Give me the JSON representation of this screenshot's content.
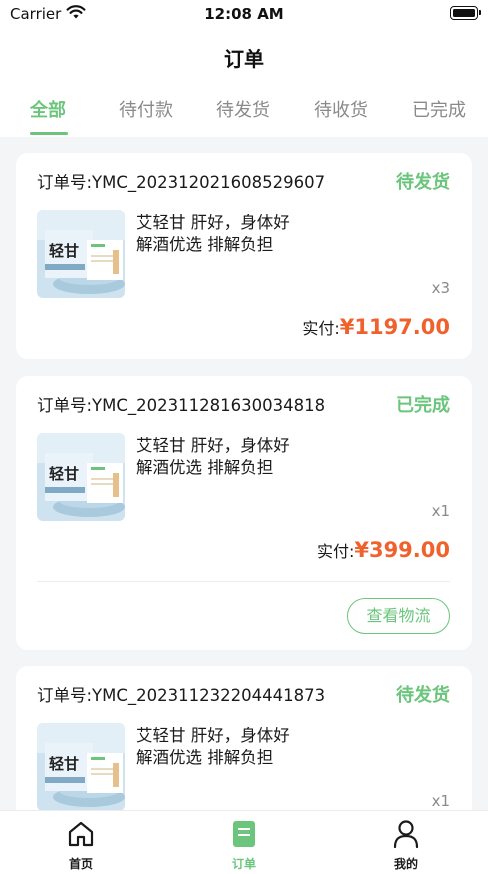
{
  "status_bar": {
    "carrier": "Carrier",
    "time": "12:08 AM"
  },
  "nav": {
    "title": "订单"
  },
  "tabs": [
    {
      "label": "全部",
      "active": true
    },
    {
      "label": "待付款",
      "active": false
    },
    {
      "label": "待发货",
      "active": false
    },
    {
      "label": "待收货",
      "active": false
    },
    {
      "label": "已完成",
      "active": false
    }
  ],
  "orders": [
    {
      "order_no": "订单号:YMC_20231202160852960 7",
      "status": "待发货",
      "product_name": "艾轻甘 肝好，身体好 解酒优选 排解负担",
      "thumb_text": "轻甘",
      "qty": "x3",
      "pay_label": "实付:",
      "price": "¥1197.00"
    },
    {
      "order_no": "订单号:YMC_20231128163003481 8",
      "status": "已完成",
      "product_name": "艾轻甘 肝好，身体好 解酒优选 排解负担",
      "thumb_text": "轻甘",
      "qty": "x1",
      "pay_label": "实付:",
      "price": "¥399.00",
      "action": "查看物流"
    },
    {
      "order_no": "订单号:YMC_20231123220444187 3",
      "status": "待发货",
      "product_name": "艾轻甘 肝好，身体好 解酒优选 排解负担",
      "thumb_text": "轻甘",
      "qty": "x1"
    }
  ],
  "tabbar": [
    {
      "label": "首页",
      "icon": "home-icon"
    },
    {
      "label": "订单",
      "icon": "order-icon",
      "active": true
    },
    {
      "label": "我的",
      "icon": "profile-icon"
    }
  ],
  "colors": {
    "accent": "#6cc57c",
    "price": "#f0622d"
  }
}
